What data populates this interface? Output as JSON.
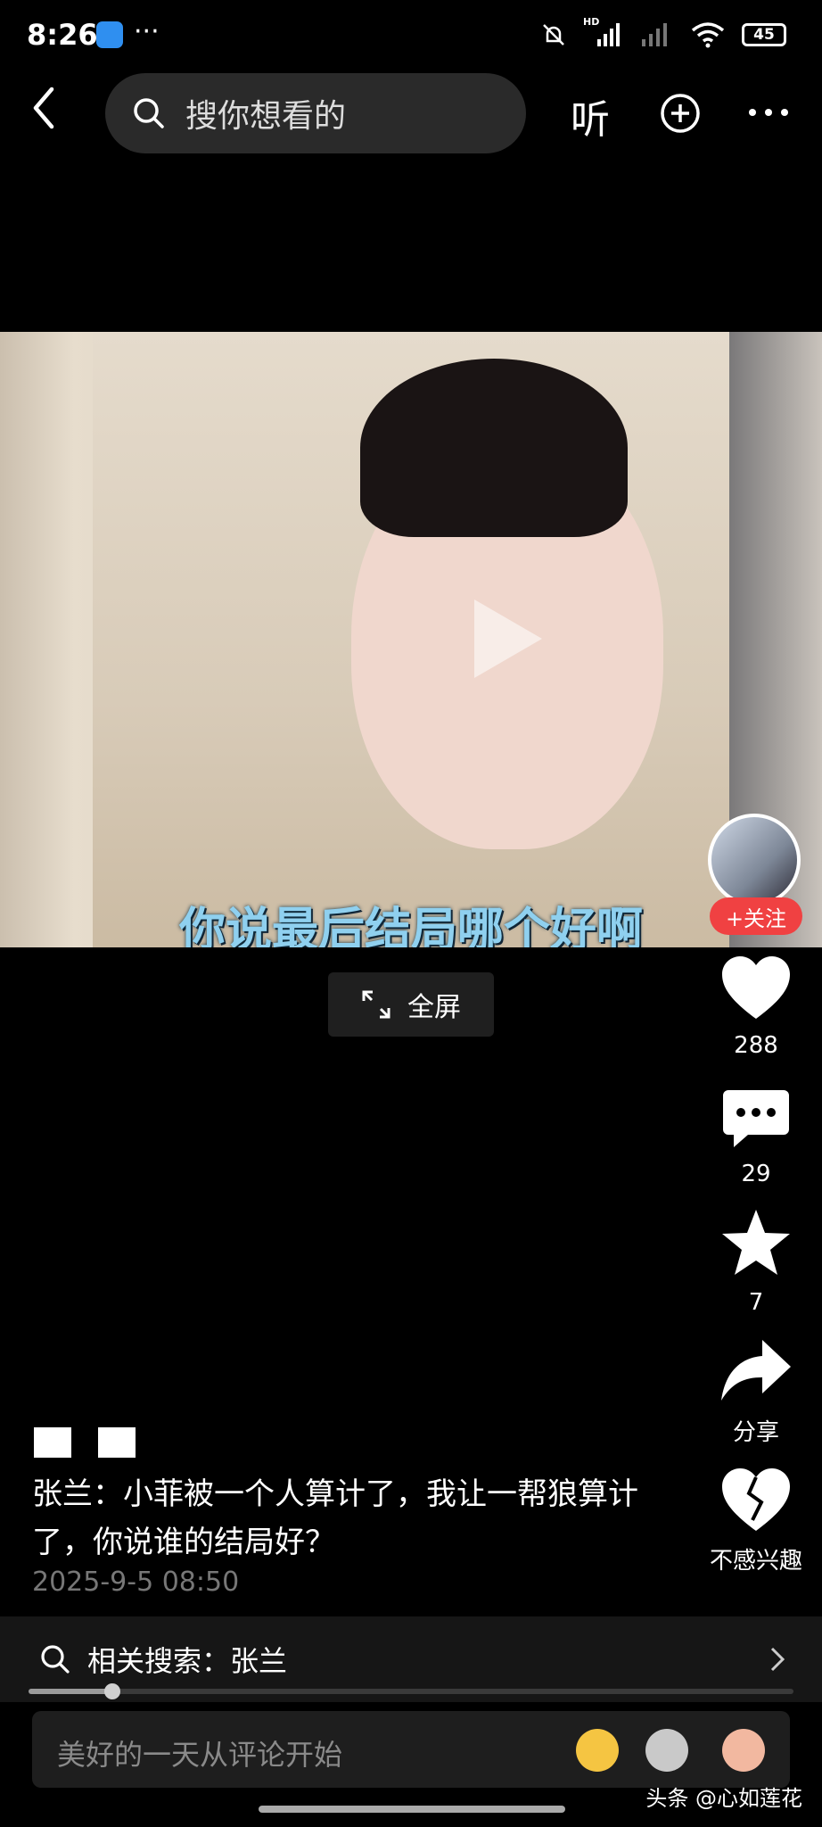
{
  "status_bar": {
    "time": "8:26",
    "more_dots": "···",
    "battery": "45",
    "hd_label": "HD"
  },
  "top_bar": {
    "search_placeholder": "搜你想看的",
    "listen_label": "听"
  },
  "video": {
    "subtitle": "你说最后结局哪个好啊",
    "fullscreen_label": "全屏"
  },
  "side_rail": {
    "follow_label": "+关注",
    "like_count": "288",
    "comment_count": "29",
    "favorite_count": "7",
    "share_label": "分享",
    "not_interested_label": "不感兴趣"
  },
  "post": {
    "caption": "张兰：小菲被一个人算计了，我让一帮狼算计了，你说谁的结局好？",
    "date": "2025-9-5 08:50"
  },
  "related_search": {
    "label": "相关搜索：张兰"
  },
  "progress": {
    "played_fraction": 0.11
  },
  "comment_bar": {
    "placeholder": "美好的一天从评论开始"
  },
  "watermark": "头条 @心如莲花",
  "colors": {
    "follow_red": "#f04142",
    "subtitle_blue": "#8fd0ef",
    "app_icon_blue": "#2f8ff0"
  },
  "icons": [
    "back-arrow-icon",
    "search-icon",
    "plus-circle-icon",
    "more-icon",
    "heart-icon",
    "comment-icon",
    "star-icon",
    "share-icon",
    "broken-heart-icon",
    "expand-icon",
    "chevron-right-icon"
  ]
}
